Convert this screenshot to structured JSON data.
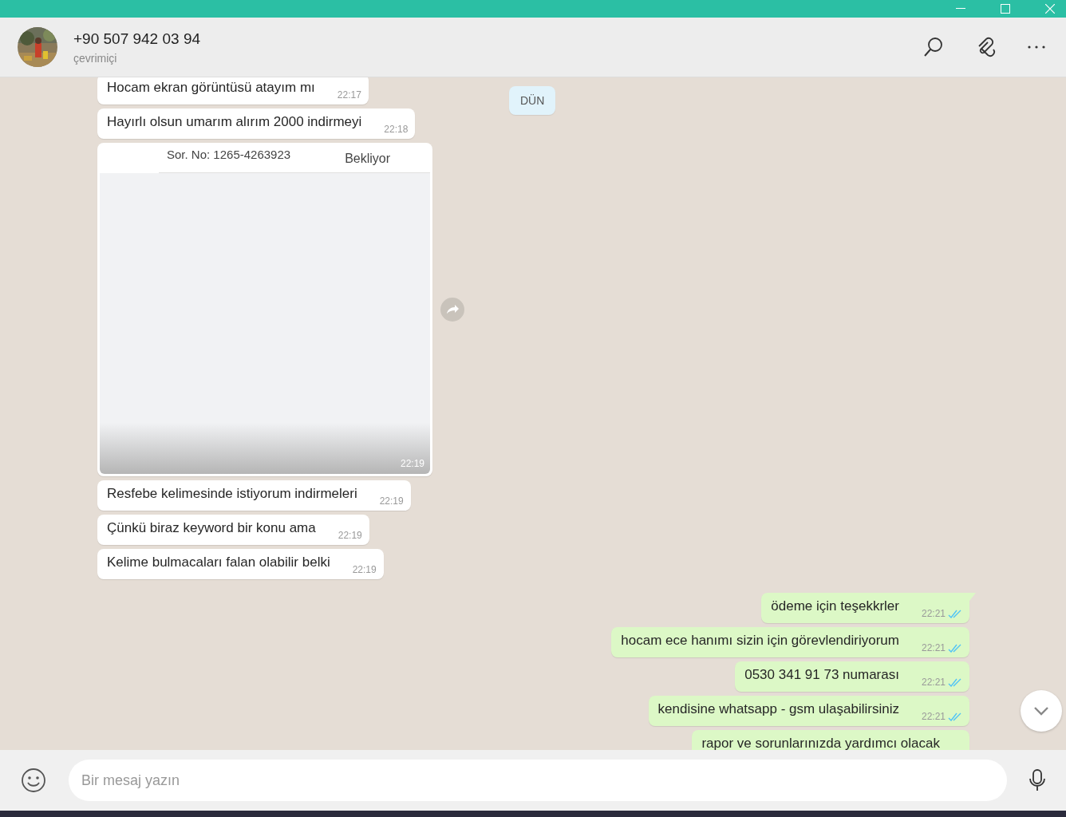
{
  "header": {
    "contact_name": "+90 507 942 03 94",
    "status": "çevrimiçi"
  },
  "date_chip": "DÜN",
  "messages": [
    {
      "kind": "text",
      "outgoing": false,
      "text": "Hocam ekran görüntüsü atayım mı",
      "time": "22:17"
    },
    {
      "kind": "text",
      "outgoing": false,
      "text": "Hayırlı olsun umarım alırım 2000 indirmeyi",
      "time": "22:18"
    },
    {
      "outgoing": false,
      "screenshot": {
        "left_text": "Sor. No: 1265-4263923",
        "right_text": "Bekliyor"
      },
      "time": "22:19"
    },
    {
      "kind": "text",
      "outgoing": false,
      "text": "Resfebe kelimesinde istiyorum indirmeleri",
      "time": "22:19"
    },
    {
      "kind": "text",
      "outgoing": false,
      "text": "Çünkü biraz keyword bir konu ama",
      "time": "22:19"
    },
    {
      "kind": "text",
      "outgoing": false,
      "text": "Kelime bulmacaları falan olabilir belki",
      "time": "22:19"
    },
    {
      "kind": "text",
      "outgoing": true,
      "text": "ödeme için teşekkrler",
      "time": "22:21",
      "read": true
    },
    {
      "kind": "text",
      "outgoing": true,
      "text": "hocam ece hanımı sizin için görevlendiriyorum",
      "time": "22:21",
      "read": true
    },
    {
      "kind": "text",
      "outgoing": true,
      "text": "0530 341 91 73 numarası",
      "time": "22:21",
      "read": true
    },
    {
      "kind": "text",
      "outgoing": true,
      "text": "kendisine whatsapp - gsm ulaşabilirsiniz",
      "time": "22:21",
      "read": true
    },
    {
      "kind": "text",
      "outgoing": true,
      "text": "rapor ve sorunlarınızda yardımcı olacak"
    }
  ],
  "composer": {
    "placeholder": "Bir mesaj yazın"
  }
}
